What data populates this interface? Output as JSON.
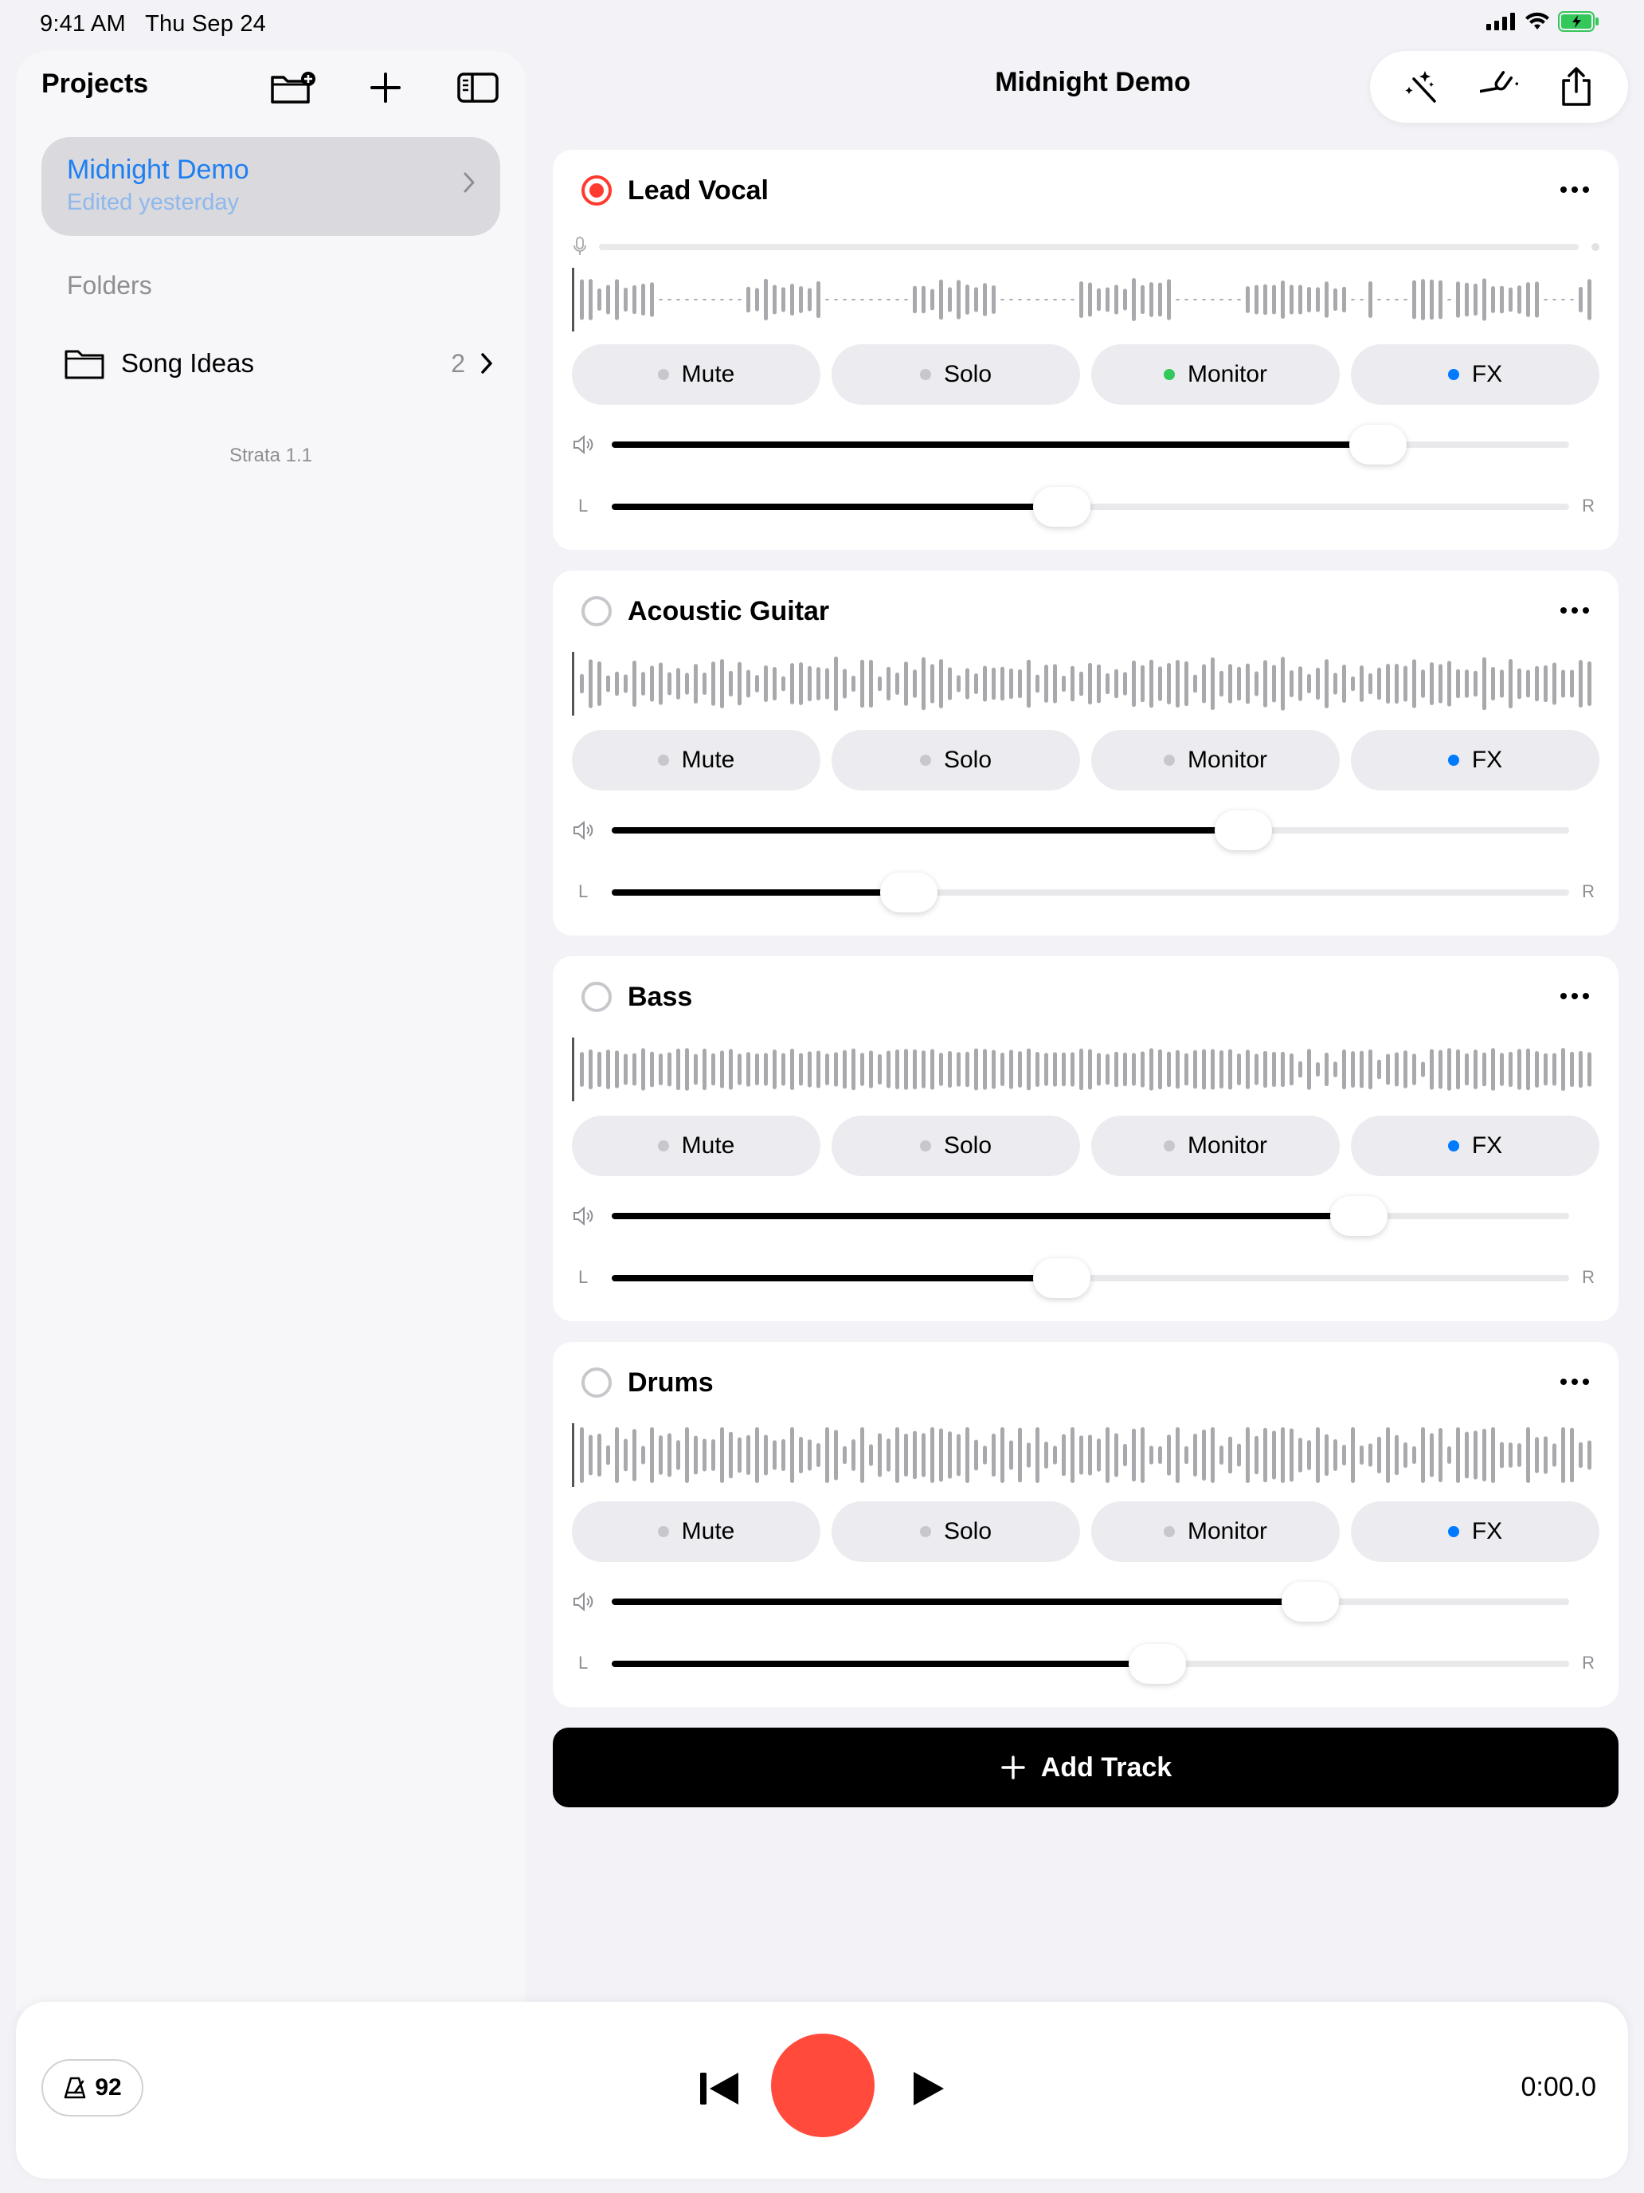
{
  "status_bar": {
    "time": "9:41 AM",
    "date": "Thu Sep 24"
  },
  "sidebar": {
    "title": "Projects",
    "project": {
      "name": "Midnight Demo",
      "subtitle": "Edited yesterday"
    },
    "folders_heading": "Folders",
    "folder": {
      "name": "Song Ideas",
      "count": "2"
    },
    "version": "Strata 1.1"
  },
  "header": {
    "title": "Midnight Demo"
  },
  "tracks": [
    {
      "name": "Lead Vocal",
      "armed": true,
      "mute": "Mute",
      "solo": "Solo",
      "monitor": "Monitor",
      "fx": "FX",
      "monitor_on": true,
      "volume": 0.8,
      "pan": 0.47
    },
    {
      "name": "Acoustic Guitar",
      "armed": false,
      "mute": "Mute",
      "solo": "Solo",
      "monitor": "Monitor",
      "fx": "FX",
      "monitor_on": false,
      "volume": 0.66,
      "pan": 0.31
    },
    {
      "name": "Bass",
      "armed": false,
      "mute": "Mute",
      "solo": "Solo",
      "monitor": "Monitor",
      "fx": "FX",
      "monitor_on": false,
      "volume": 0.78,
      "pan": 0.47
    },
    {
      "name": "Drums",
      "armed": false,
      "mute": "Mute",
      "solo": "Solo",
      "monitor": "Monitor",
      "fx": "FX",
      "monitor_on": false,
      "volume": 0.73,
      "pan": 0.57
    }
  ],
  "pan_labels": {
    "left": "L",
    "right": "R"
  },
  "add_track_label": "Add Track",
  "transport": {
    "tempo": "92",
    "time": "0:00.0"
  },
  "colors": {
    "accent": "#1e7ff0",
    "record": "#ff4a3c",
    "monitor_on": "#34c759",
    "fx": "#007aff"
  },
  "icons": [
    "new-folder-icon",
    "plus-icon",
    "sidebar-icon",
    "chevron-right-icon",
    "folder-icon",
    "magic-wand-icon",
    "tuning-fork-icon",
    "share-icon",
    "microphone-icon",
    "speaker-icon",
    "metronome-icon",
    "rewind-icon",
    "play-icon"
  ]
}
